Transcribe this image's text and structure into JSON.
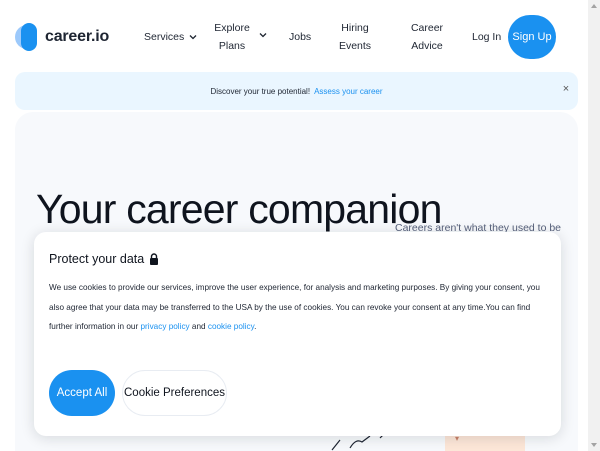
{
  "header": {
    "logo_text": "career.io",
    "nav": {
      "services": "Services",
      "explore_line1": "Explore",
      "explore_line2": "Plans",
      "jobs": "Jobs",
      "hiring_line1": "Hiring",
      "hiring_line2": "Events",
      "career_line1": "Career",
      "career_line2": "Advice",
      "login": "Log In",
      "signup": "Sign Up"
    }
  },
  "banner": {
    "text": "Discover your true potential!",
    "link": "Assess your career",
    "close": "×"
  },
  "hero": {
    "title": "Your career companion",
    "subtitle": "Careers aren't what they used to be"
  },
  "cookie": {
    "title": "Protect your data",
    "body_part1": "We use cookies to provide our services, improve the user experience, for analysis and marketing purposes. By giving your consent, you also agree that your data may be transferred to the USA by the use of cookies. You can revoke your consent at any time.You can find further information in our ",
    "privacy_link": "privacy policy",
    "and_text": " and ",
    "cookie_link": "cookie policy",
    "period": ".",
    "accept_label": "Accept All",
    "prefs_label": "Cookie Preferences"
  },
  "colors": {
    "accent": "#1a91f0",
    "banner_bg": "#eaf6ff",
    "hero_bg": "#f7f9fc"
  },
  "icons": {
    "logo": "career-io-logo-icon",
    "chevron": "chevron-down-icon",
    "close": "close-icon",
    "lock": "lock-icon"
  }
}
